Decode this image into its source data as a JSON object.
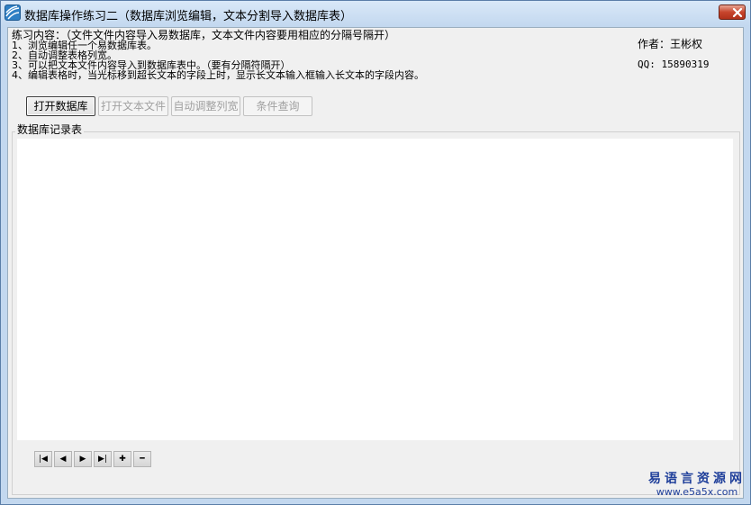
{
  "window": {
    "title": "数据库操作练习二（数据库浏览编辑，文本分割导入数据库表）"
  },
  "info": {
    "title": "练习内容：（文件文件内容导入易数据库，文本文件内容要用相应的分隔号隔开）",
    "lines": [
      "1、浏览编辑任一个易数据库表。",
      "2、自动调整表格列宽。",
      "3、可以把文本文件内容导入到数据库表中。（要有分隔符隔开）",
      "4、编辑表格时，当光标移到超长文本的字段上时，显示长文本输入框输入长文本的字段内容。"
    ],
    "author": "作者：王彬权",
    "qq": "QQ: 15890319"
  },
  "toolbar": {
    "open_db": "打开数据库",
    "open_text": "打开文本文件",
    "auto_width": "自动调整列宽",
    "query": "条件查询"
  },
  "group": {
    "label": "数据库记录表"
  },
  "nav": {
    "first": "|◀",
    "prev": "◀",
    "next": "▶",
    "last": "▶|",
    "add": "✚",
    "remove": "━"
  },
  "watermark": {
    "cn": "易语言资源网",
    "url": "www.e5a5x.com"
  },
  "icons": {
    "app": "app-icon",
    "close": "close-icon"
  },
  "colors": {
    "title_bg": "#c3d8ef",
    "close_red": "#c7452c",
    "client_bg": "#f0f0f0",
    "watermark": "#1f3f9a"
  }
}
